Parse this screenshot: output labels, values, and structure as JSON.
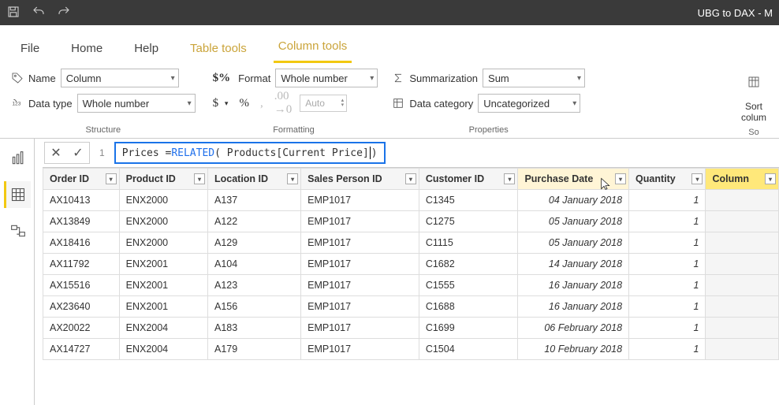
{
  "title": "UBG to DAX - M",
  "tabs": {
    "file": "File",
    "home": "Home",
    "help": "Help",
    "tabletools": "Table tools",
    "coltools": "Column tools"
  },
  "structure": {
    "name_label": "Name",
    "name_value": "Column",
    "dtype_label": "Data type",
    "dtype_value": "Whole number",
    "group": "Structure"
  },
  "formatting": {
    "format_label": "Format",
    "format_value": "Whole number",
    "auto": "Auto",
    "group": "Formatting",
    "dollar": "$",
    "pct": "%",
    "comma": ",",
    "dec": ".00"
  },
  "properties": {
    "sum_label": "Summarization",
    "sum_value": "Sum",
    "cat_label": "Data category",
    "cat_value": "Uncategorized",
    "group": "Properties"
  },
  "sort": {
    "label1": "Sort",
    "label2": "colum",
    "group": "So"
  },
  "formula": {
    "line": "1",
    "p1": "Prices = ",
    "kw": "RELATED",
    "p2": "( Products[Current Price] ",
    "p3": ")"
  },
  "columns": [
    "Order ID",
    "Product ID",
    "Location ID",
    "Sales Person ID",
    "Customer ID",
    "Purchase Date",
    "Quantity",
    "Column"
  ],
  "rows": [
    {
      "oid": "AX10413",
      "pid": "ENX2000",
      "loc": "A137",
      "sp": "EMP1017",
      "cust": "C1345",
      "date": "04 January 2018",
      "qty": "1"
    },
    {
      "oid": "AX13849",
      "pid": "ENX2000",
      "loc": "A122",
      "sp": "EMP1017",
      "cust": "C1275",
      "date": "05 January 2018",
      "qty": "1"
    },
    {
      "oid": "AX18416",
      "pid": "ENX2000",
      "loc": "A129",
      "sp": "EMP1017",
      "cust": "C1115",
      "date": "05 January 2018",
      "qty": "1"
    },
    {
      "oid": "AX11792",
      "pid": "ENX2001",
      "loc": "A104",
      "sp": "EMP1017",
      "cust": "C1682",
      "date": "14 January 2018",
      "qty": "1"
    },
    {
      "oid": "AX15516",
      "pid": "ENX2001",
      "loc": "A123",
      "sp": "EMP1017",
      "cust": "C1555",
      "date": "16 January 2018",
      "qty": "1"
    },
    {
      "oid": "AX23640",
      "pid": "ENX2001",
      "loc": "A156",
      "sp": "EMP1017",
      "cust": "C1688",
      "date": "16 January 2018",
      "qty": "1"
    },
    {
      "oid": "AX20022",
      "pid": "ENX2004",
      "loc": "A183",
      "sp": "EMP1017",
      "cust": "C1699",
      "date": "06 February 2018",
      "qty": "1"
    },
    {
      "oid": "AX14727",
      "pid": "ENX2004",
      "loc": "A179",
      "sp": "EMP1017",
      "cust": "C1504",
      "date": "10 February 2018",
      "qty": "1"
    }
  ]
}
